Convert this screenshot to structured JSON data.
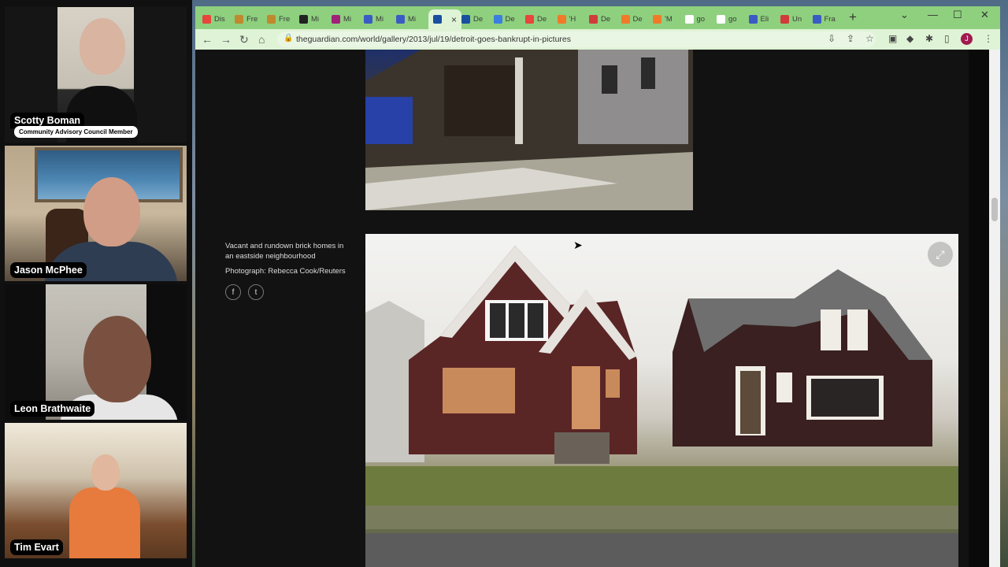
{
  "participants": [
    {
      "name": "Scotty Boman",
      "subtitle": "Community Advisory Council Member"
    },
    {
      "name": "Jason McPhee"
    },
    {
      "name": "Leon Brathwaite"
    },
    {
      "name": "Tim Evart"
    }
  ],
  "browser": {
    "tabs": [
      {
        "label": "Dis",
        "color": "#e8453c"
      },
      {
        "label": "Fre",
        "color": "#c0892e"
      },
      {
        "label": "Fre",
        "color": "#c0892e"
      },
      {
        "label": "Mi",
        "color": "#222222"
      },
      {
        "label": "Mi",
        "color": "#a1207a"
      },
      {
        "label": "Mi",
        "color": "#3b5bc4"
      },
      {
        "label": "Mi",
        "color": "#3b5bc4"
      },
      {
        "label": "",
        "color": "#1a4ea0"
      },
      {
        "label": "De",
        "color": "#1a4ea0"
      },
      {
        "label": "De",
        "color": "#3b7de0"
      },
      {
        "label": "De",
        "color": "#e8453c"
      },
      {
        "label": "'H",
        "color": "#f07a2a"
      },
      {
        "label": "De",
        "color": "#d13b3b"
      },
      {
        "label": "De",
        "color": "#f07a2a"
      },
      {
        "label": "'M",
        "color": "#f07a2a"
      },
      {
        "label": "go",
        "color": "#ffffff"
      },
      {
        "label": "go",
        "color": "#ffffff"
      },
      {
        "label": "Eli",
        "color": "#3b5bc4"
      },
      {
        "label": "Un",
        "color": "#d13b3b"
      },
      {
        "label": "Fra",
        "color": "#3b5bc4"
      }
    ],
    "url": "theguardian.com/world/gallery/2013/jul/19/detroit-goes-bankrupt-in-pictures",
    "avatar_letter": "J"
  },
  "gallery": {
    "caption": "Vacant and rundown brick homes in an eastside neighbourhood",
    "credit": "Photograph: Rebecca Cook/Reuters"
  },
  "icons": {
    "facebook": "f",
    "twitter": "t",
    "expand": "⤢"
  }
}
